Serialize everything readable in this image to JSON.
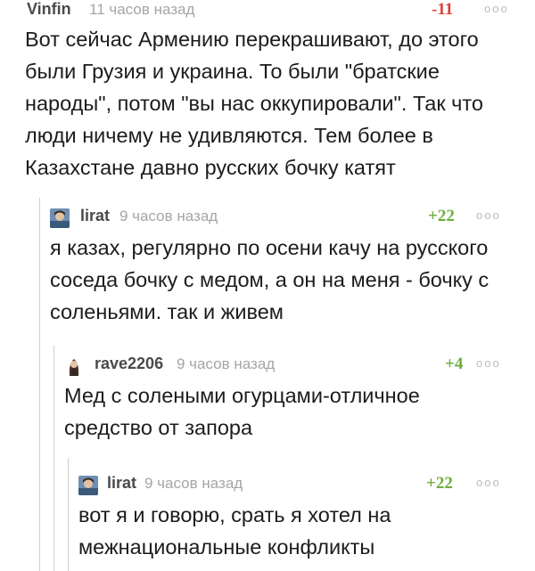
{
  "comments": [
    {
      "author": "Vinfin",
      "time": "11 часов назад",
      "rating": "-11",
      "dots": "ooo",
      "text": "Вот сейчас Армению перекрашивают, до этого\nбыли Грузия и украина. То были \"братские\nнароды\", потом \"вы нас оккупировали\". Так что\nлюди ничему не удивляются. Тем более в\nКазахстане давно русских бочку катят"
    },
    {
      "author": "lirat",
      "time": "9 часов назад",
      "rating": "+22",
      "dots": "ooo",
      "text": "я казах, регулярно по осени качу на русского\nсоседа бочку с медом, а он на меня - бочку с\nсоленьями. так и живем"
    },
    {
      "author": "rave2206",
      "time": "9 часов назад",
      "rating": "+4",
      "dots": "ooo",
      "text": "Мед с солеными огурцами-отличное\nсредство от запора"
    },
    {
      "author": "lirat",
      "time": "9 часов назад",
      "rating": "+22",
      "dots": "ooo",
      "text": "вот я и говорю, срать я хотел на\nмежнациональные конфликты"
    }
  ],
  "colors": {
    "negative_rating": "#d9423a",
    "positive_rating": "#6cae3c",
    "meta_text": "#a5a5a5",
    "branch_line": "#d0d0d0"
  }
}
